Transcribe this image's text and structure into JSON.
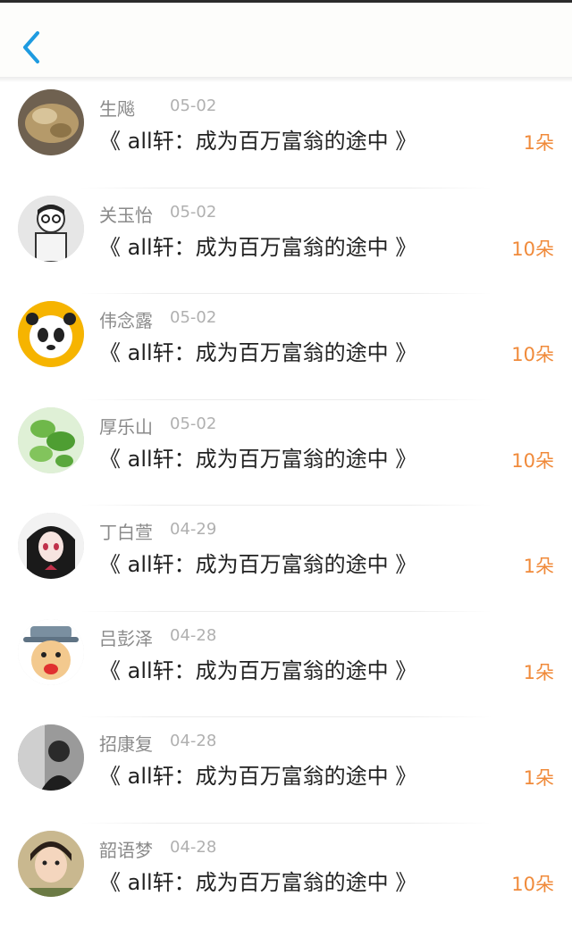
{
  "header": {
    "back_icon": "chevron-left-icon",
    "accent_color": "#1e9be0"
  },
  "colors": {
    "name": "#8a8a8a",
    "date": "#b0b0b0",
    "title": "#222222",
    "count": "#f08a3a"
  },
  "items": [
    {
      "name": "生飚",
      "date": "05-02",
      "title": "《 all轩：成为百万富翁的途中 》",
      "count": "1朵",
      "avatar": "avatar-brown-object"
    },
    {
      "name": "关玉怡",
      "date": "05-02",
      "title": "《 all轩：成为百万富翁的途中 》",
      "count": "10朵",
      "avatar": "avatar-sketch-boy"
    },
    {
      "name": "伟念露",
      "date": "05-02",
      "title": "《 all轩：成为百万富翁的途中 》",
      "count": "10朵",
      "avatar": "avatar-panda"
    },
    {
      "name": "厚乐山",
      "date": "05-02",
      "title": "《 all轩：成为百万富翁的途中 》",
      "count": "10朵",
      "avatar": "avatar-green-leaves"
    },
    {
      "name": "丁白萱",
      "date": "04-29",
      "title": "《 all轩：成为百万富翁的途中 》",
      "count": "1朵",
      "avatar": "avatar-anime-girl"
    },
    {
      "name": "吕彭泽",
      "date": "04-28",
      "title": "《 all轩：成为百万富翁的途中 》",
      "count": "1朵",
      "avatar": "avatar-cartoon-old-man"
    },
    {
      "name": "招康复",
      "date": "04-28",
      "title": "《 all轩：成为百万富翁的途中 》",
      "count": "1朵",
      "avatar": "avatar-bw-photo"
    },
    {
      "name": "韶语梦",
      "date": "04-28",
      "title": "《 all轩：成为百万富翁的途中 》",
      "count": "10朵",
      "avatar": "avatar-young-man"
    }
  ]
}
